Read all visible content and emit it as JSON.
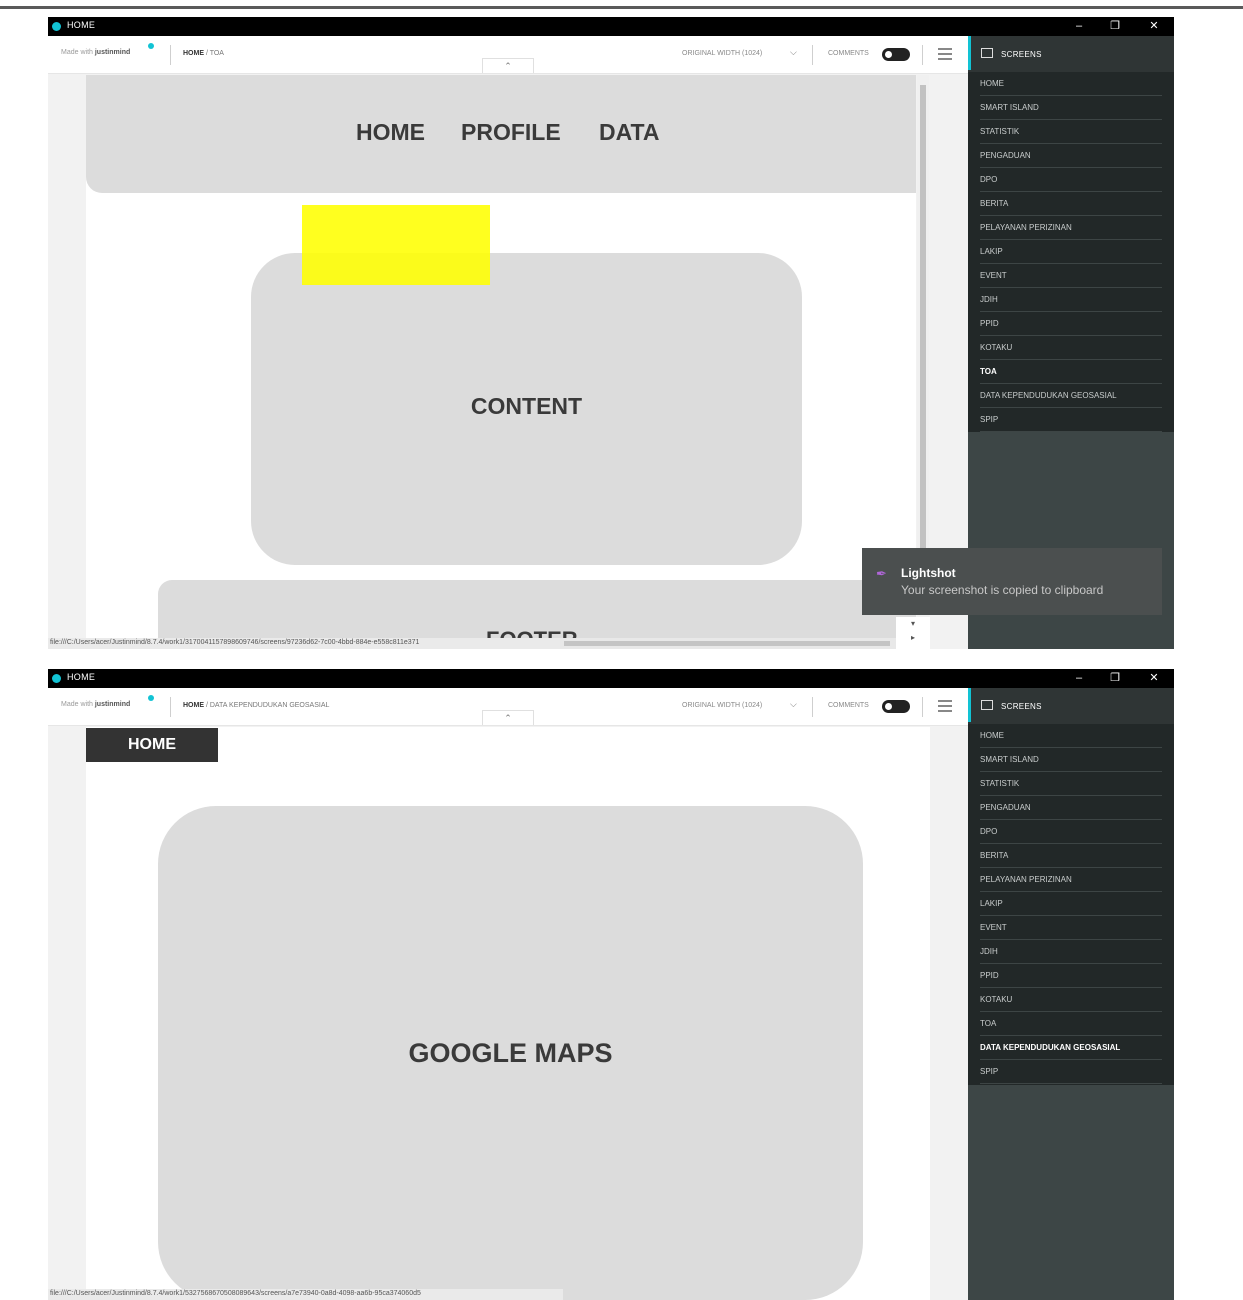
{
  "windows": [
    {
      "title": "HOME",
      "toolbar": {
        "made_with": "Made with",
        "brand": "justinmind",
        "breadcrumb_root": "HOME",
        "breadcrumb_current": " / TOA",
        "width_label": "ORIGINAL WIDTH (1024)",
        "comments_label": "COMMENTS"
      },
      "canvas": {
        "nav": [
          "HOME",
          "PROFILE",
          "DATA"
        ],
        "content_label": "CONTENT",
        "footer_label": "FOOTER"
      },
      "status_url": "file:///C:/Users/acer/Justinmind/8.7.4/work1/3170041157898609746/screens/97236d62-7c00-4bbd-884e-e558c811e371",
      "toast": {
        "title": "Lightshot",
        "message": "Your screenshot is copied to clipboard"
      }
    },
    {
      "title": "HOME",
      "toolbar": {
        "made_with": "Made with",
        "brand": "justinmind",
        "breadcrumb_root": "HOME",
        "breadcrumb_current": " / DATA KEPENDUDUKAN GEOSASIAL",
        "width_label": "ORIGINAL WIDTH (1024)",
        "comments_label": "COMMENTS"
      },
      "canvas": {
        "home_button": "HOME",
        "maps_label": "GOOGLE MAPS"
      },
      "status_url": "file:///C:/Users/acer/Justinmind/8.7.4/work1/5327568670508089643/screens/a7e73940-0a8d-4098-aa6b-95ca374060d5"
    }
  ],
  "sidebar": {
    "header": "SCREENS",
    "items": [
      "HOME",
      "SMART ISLAND",
      "STATISTIK",
      "PENGADUAN",
      "DPO",
      "BERITA",
      "PELAYANAN PERIZINAN",
      "LAKIP",
      "EVENT",
      "JDIH",
      "PPID",
      "KOTAKU",
      "TOA",
      "DATA KEPENDUDUKAN GEOSASIAL",
      "SPIP"
    ],
    "active_window1": "TOA",
    "active_window2": "DATA KEPENDUDUKAN GEOSASIAL"
  },
  "window_controls": {
    "minimize": "–",
    "maximize": "❐",
    "close": "✕"
  },
  "icons": [
    "app-dot-icon",
    "chevron-down-icon",
    "chevron-up-icon",
    "menu-icon",
    "screens-icon",
    "feather-icon",
    "minimize-icon",
    "maximize-icon",
    "close-icon"
  ],
  "colors": {
    "accent": "#12c3d4",
    "sidebar": "#2f3535",
    "highlight": "#ffff00",
    "box": "#dcdcdc"
  }
}
